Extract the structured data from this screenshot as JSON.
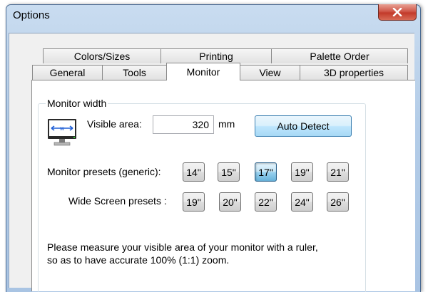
{
  "window": {
    "title": "Options"
  },
  "tabs": {
    "row1": [
      "Colors/Sizes",
      "Printing",
      "Palette Order"
    ],
    "row2": [
      "General",
      "Tools",
      "Monitor",
      "View",
      "3D properties"
    ],
    "active": "Monitor"
  },
  "monitor_width": {
    "group_label": "Monitor width",
    "visible_area_label": "Visible area:",
    "visible_area_value": "320",
    "unit": "mm",
    "auto_detect_label": "Auto Detect"
  },
  "presets": {
    "generic_label": "Monitor presets (generic):",
    "generic": [
      "14\"",
      "15\"",
      "17\"",
      "19\"",
      "21\""
    ],
    "generic_selected": "17\"",
    "wide_label": "Wide Screen presets :",
    "wide": [
      "19\"",
      "20\"",
      "22\"",
      "24\"",
      "26\""
    ]
  },
  "note": {
    "line1": "Please measure your visible area of your monitor with a ruler,",
    "line2": "so as to have accurate 100% (1:1) zoom."
  }
}
